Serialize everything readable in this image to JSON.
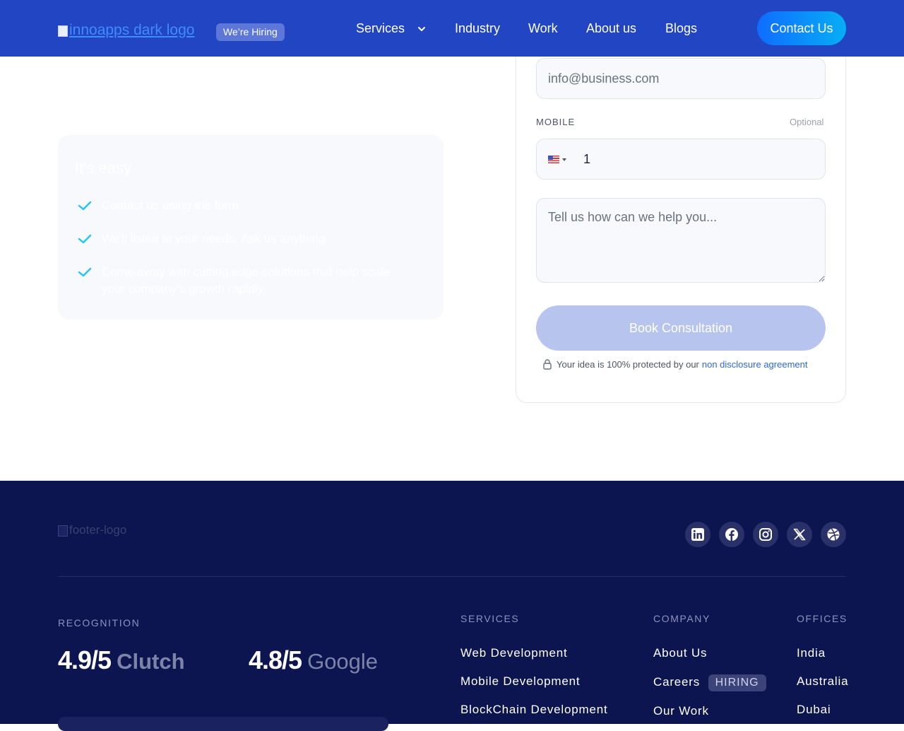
{
  "header": {
    "logo_alt": "innoapps dark logo",
    "hiring_badge": "We’re Hiring",
    "nav": {
      "services": "Services",
      "industry": "Industry",
      "work": "Work",
      "about": "About us",
      "blogs": "Blogs"
    },
    "contact_button": "Contact Us"
  },
  "easy_card": {
    "title": "It's easy",
    "items": [
      "Contact us using the form",
      "We'll listen to your needs. Ask us anything",
      "Come away with cutting edge solutions that help scale your company's growth rapidly"
    ]
  },
  "form": {
    "email_placeholder": "info@business.com",
    "mobile_label": "MOBILE",
    "optional_label": "Optional",
    "phone_value": "1",
    "message_placeholder": "Tell us how can we help you...",
    "submit_label": "Book Consultation",
    "nda_text": "Your idea is 100% protected by our",
    "nda_link": "non disclosure agreement"
  },
  "footer": {
    "logo_alt": "footer-logo",
    "socials": [
      "linkedin-icon",
      "facebook-icon",
      "instagram-icon",
      "x-icon",
      "dribbble-icon"
    ],
    "recognition": {
      "title": "RECOGNITION",
      "clutch_score": "4.9/5",
      "clutch_label": "Clutch",
      "google_score": "4.8/5",
      "google_label": "Google"
    },
    "services": {
      "title": "SERVICES",
      "items": [
        "Web Development",
        "Mobile Development",
        "BlockChain Development"
      ]
    },
    "company": {
      "title": "COMPANY",
      "items": [
        "About Us",
        "Careers",
        "Our Work"
      ],
      "hiring_tag": "HIRING"
    },
    "offices": {
      "title": "OFFICES",
      "items": [
        "India",
        "Australia",
        "Dubai"
      ]
    }
  },
  "colors": {
    "header_bg": "#2145c3",
    "footer_bg": "#0d1551",
    "accent": "#0f6cff",
    "check": "#1ec6f0",
    "button_disabled": "#b7c4ee"
  }
}
